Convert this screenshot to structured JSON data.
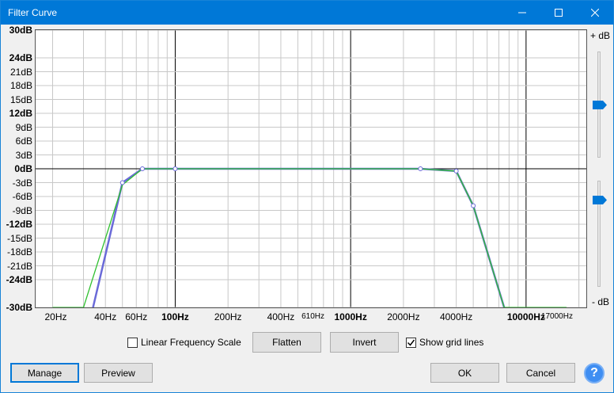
{
  "window": {
    "title": "Filter Curve"
  },
  "y_axis": {
    "labels": [
      "30dB",
      "24dB",
      "21dB",
      "18dB",
      "15dB",
      "12dB",
      "9dB",
      "6dB",
      "3dB",
      "0dB",
      "-3dB",
      "-6dB",
      "-9dB",
      "-12dB",
      "-15dB",
      "-18dB",
      "-21dB",
      "-24dB",
      "-30dB"
    ],
    "bold": [
      "30dB",
      "24dB",
      "12dB",
      "0dB",
      "-12dB",
      "-24dB",
      "-30dB"
    ]
  },
  "x_axis": {
    "labels": [
      {
        "text": "20Hz",
        "hz": 20
      },
      {
        "text": "40Hz",
        "hz": 40
      },
      {
        "text": "60Hz",
        "hz": 60
      },
      {
        "text": "100Hz",
        "hz": 100,
        "bold": true
      },
      {
        "text": "200Hz",
        "hz": 200
      },
      {
        "text": "400Hz",
        "hz": 400
      },
      {
        "text": "610Hz",
        "hz": 610,
        "small": true
      },
      {
        "text": "1000Hz",
        "hz": 1000,
        "bold": true
      },
      {
        "text": "2000Hz",
        "hz": 2000
      },
      {
        "text": "4000Hz",
        "hz": 4000
      },
      {
        "text": "10000Hz",
        "hz": 10000,
        "bold": true
      },
      {
        "text": "17000Hz",
        "hz": 17000,
        "small": true
      }
    ]
  },
  "chart_data": {
    "type": "line",
    "x_scale": "log",
    "xlim": [
      16,
      22050
    ],
    "ylim": [
      -30,
      30
    ],
    "grid": true,
    "series": [
      {
        "color": "#6a6ad8",
        "points": [
          [
            34,
            -30
          ],
          [
            50,
            -3
          ],
          [
            65,
            0
          ],
          [
            100,
            0
          ],
          [
            2500,
            0
          ],
          [
            4000,
            -0.5
          ],
          [
            5000,
            -8
          ],
          [
            7500,
            -30
          ]
        ]
      },
      {
        "color": "#2fc02f",
        "points": [
          [
            20,
            -30
          ],
          [
            30,
            -30
          ],
          [
            50,
            -3.5
          ],
          [
            65,
            0
          ],
          [
            100,
            0
          ],
          [
            2500,
            0
          ],
          [
            4000,
            -0.5
          ],
          [
            5000,
            -8
          ],
          [
            7500,
            -30
          ],
          [
            17000,
            -30
          ]
        ]
      }
    ],
    "control_points": [
      [
        50,
        -3
      ],
      [
        65,
        0
      ],
      [
        100,
        0
      ],
      [
        2500,
        0
      ],
      [
        4000,
        -0.5
      ],
      [
        5000,
        -8
      ]
    ]
  },
  "sliders": {
    "top_label": "+ dB",
    "bottom_label": "- dB"
  },
  "controls": {
    "linear_freq_label": "Linear Frequency Scale",
    "linear_freq_checked": false,
    "flatten_label": "Flatten",
    "invert_label": "Invert",
    "show_grid_label": "Show grid lines",
    "show_grid_checked": true
  },
  "footer": {
    "manage_label": "Manage",
    "preview_label": "Preview",
    "ok_label": "OK",
    "cancel_label": "Cancel",
    "help_glyph": "?"
  }
}
